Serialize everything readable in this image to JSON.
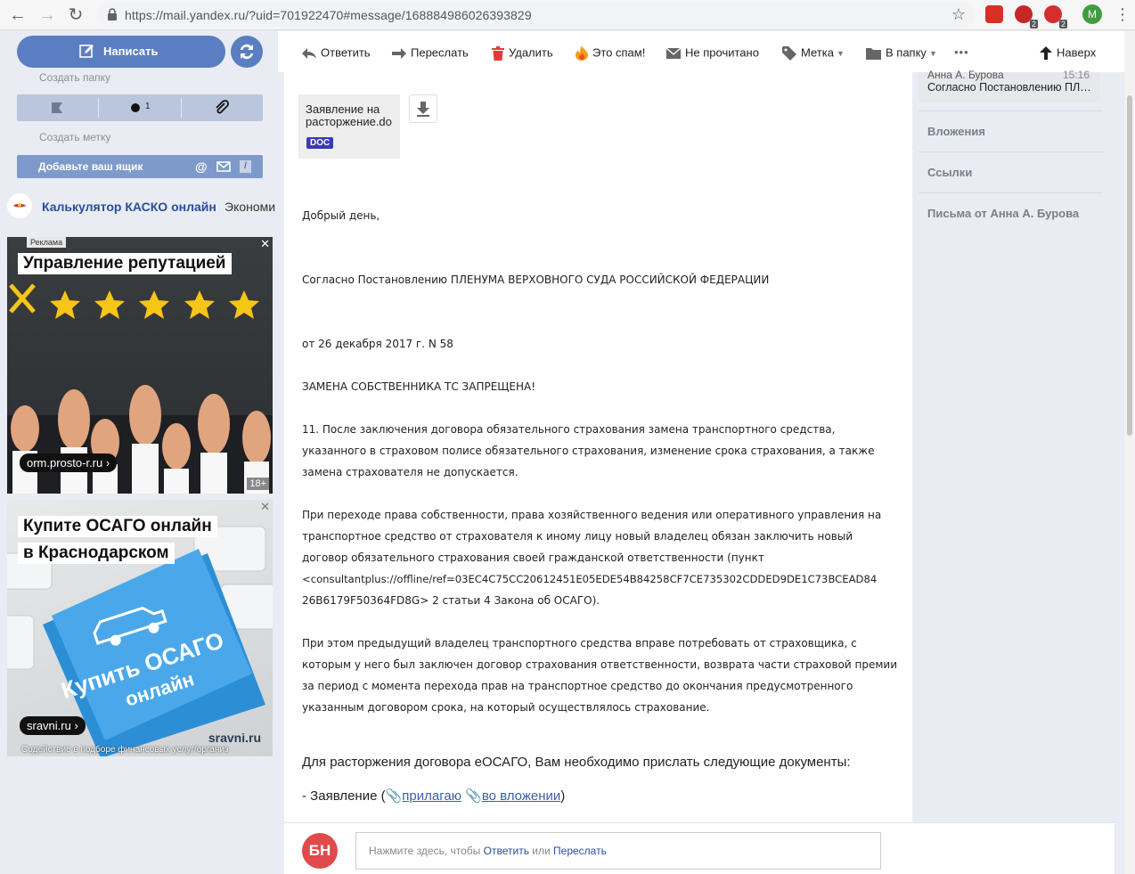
{
  "browser": {
    "url": "https://mail.yandex.ru/?uid=701922470#message/168884986026393829",
    "ext_badges": [
      "2",
      "2"
    ],
    "profile_initial": "M"
  },
  "sidebar": {
    "compose_label": "Написать",
    "create_folder": "Создать папку",
    "unread_count": "1",
    "create_label": "Создать метку",
    "add_mailbox": "Добавьте ваш ящик",
    "promo_title": "Калькулятор КАСКО онлайн",
    "promo_tail": "Экономи"
  },
  "ads": [
    {
      "tag": "Реклама",
      "headline": "Управление репутацией",
      "domain": "orm.prosto-r.ru",
      "age": "18+"
    },
    {
      "headline_1": "Купите ОСАГО онлайн",
      "headline_2": "в Краснодарском",
      "key_text_1": "Купить ОСАГО",
      "key_text_2": "онлайн",
      "brand": "sravni.ru",
      "domain": "sravni.ru",
      "footer": "Содействие в подборе финансовых услуг/организ"
    }
  ],
  "toolbar": {
    "reply": "Ответить",
    "forward": "Переслать",
    "delete": "Удалить",
    "spam": "Это спам!",
    "unread": "Не прочитано",
    "label": "Метка",
    "folder": "В папку",
    "more": "•••",
    "top": "Наверх"
  },
  "message": {
    "attachment_name": "Заявление на расторжение.do",
    "attachment_type": "DOC",
    "greeting": "Добрый день,",
    "p1": "Согласно Постановлению ПЛЕНУМА ВЕРХОВНОГО СУДА РОССИЙСКОЙ ФЕДЕРАЦИИ",
    "p2": "от 26 декабря 2017 г. N 58",
    "p3": "ЗАМЕНА СОБСТВЕННИКА ТС ЗАПРЕЩЕНА!",
    "p4": [
      "11. После заключения договора обязательного страхования замена транспортного средства,",
      "указанного в страховом полисе обязательного страхования, изменение срока страхования, а также",
      "замена страхователя не допускается."
    ],
    "p5": [
      "При переходе права собственности, права хозяйственного ведения или оперативного управления на",
      "транспортное средство от страхователя к иному лицу новый владелец обязан заключить новый",
      "договор обязательного страхования своей гражданской ответственности (пункт",
      "<consultantplus://offline/ref=03EC4C75CC20612451E05EDE54B84258CF7CE735302CDDED9DE1C73BCEAD84",
      "26B6179F50364FD8G>  2 статьи 4 Закона об ОСАГО)."
    ],
    "p6": [
      "При этом предыдущий владелец транспортного средства вправе потребовать от страховщика, с",
      "которым у него был заключен договор страхования ответственности, возврата части страховой премии",
      "за период с момента перехода прав на транспортное средство до окончания предусмотренного",
      "указанным договором срока, на который осуществлялось страхование."
    ],
    "p7": "Для расторжения договора еОСАГО, Вам необходимо прислать следующие документы:",
    "p8_prefix": "- Заявление (",
    "p8_link1": "прилагаю",
    "p8_link2": "во вложении",
    "p8_suffix": ")"
  },
  "reply": {
    "avatar": "БН",
    "prefix": "Нажмите здесь, чтобы ",
    "reply_link": "Ответить",
    "or": " или ",
    "forward_link": "Переслать"
  },
  "right_panel": {
    "thread_from": "Анна А. Бурова",
    "thread_time": "15:16",
    "thread_subject": "Согласно Постановлению ПЛЕНУМА",
    "attachments": "Вложения",
    "links": "Ссылки",
    "letters_from": "Письма от Анна А. Бурова"
  }
}
